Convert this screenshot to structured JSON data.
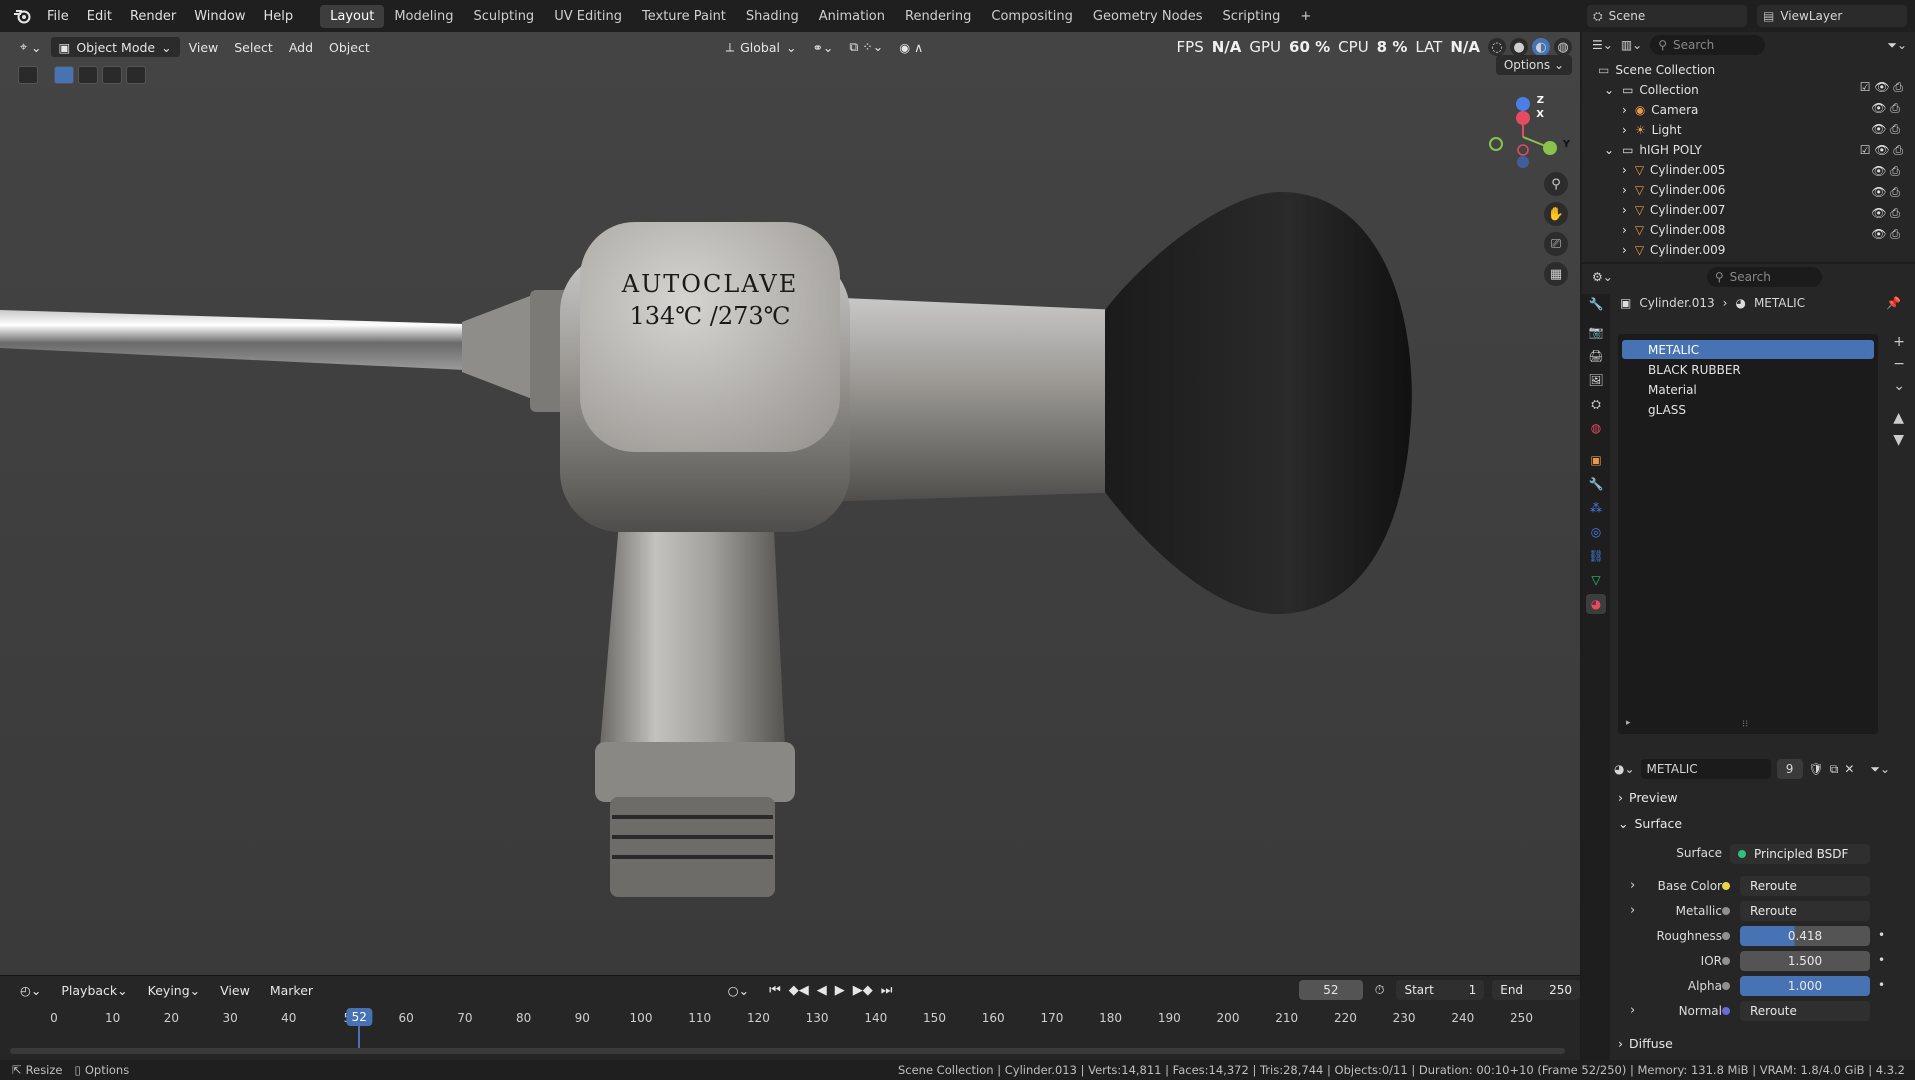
{
  "topbar": {
    "menus": [
      "File",
      "Edit",
      "Render",
      "Window",
      "Help"
    ],
    "workspaces": [
      "Layout",
      "Modeling",
      "Sculpting",
      "UV Editing",
      "Texture Paint",
      "Shading",
      "Animation",
      "Rendering",
      "Compositing",
      "Geometry Nodes",
      "Scripting"
    ],
    "active_workspace": "Layout",
    "scene_label": "Scene",
    "viewlayer_label": "ViewLayer"
  },
  "viewport": {
    "mode": "Object Mode",
    "menus": [
      "View",
      "Select",
      "Add",
      "Object"
    ],
    "transform_orientation": "Global",
    "options_label": "Options",
    "hud": {
      "fps_label": "FPS",
      "fps_value": "N/A",
      "gpu_label": "GPU",
      "gpu_value": "60 %",
      "cpu_label": "CPU",
      "cpu_value": "8 %",
      "lat_label": "LAT",
      "lat_value": "N/A"
    },
    "model_text_line1": "AUTOCLAVE",
    "model_text_line2": "134℃ /273℃",
    "gizmo_axes": [
      "Z",
      "X",
      "Y"
    ]
  },
  "timeline": {
    "menus": [
      "Playback",
      "Keying",
      "View",
      "Marker"
    ],
    "current_frame": "52",
    "start_label": "Start",
    "start_value": "1",
    "end_label": "End",
    "end_value": "250",
    "ticks": [
      "0",
      "10",
      "20",
      "30",
      "40",
      "5",
      "60",
      "70",
      "80",
      "90",
      "100",
      "110",
      "120",
      "130",
      "140",
      "150",
      "160",
      "170",
      "180",
      "190",
      "200",
      "210",
      "220",
      "230",
      "240",
      "250"
    ]
  },
  "outliner": {
    "search_placeholder": "Search",
    "rows": [
      {
        "label": "Scene Collection"
      },
      {
        "label": "Collection"
      },
      {
        "label": "Camera"
      },
      {
        "label": "Light"
      },
      {
        "label": "hIGH POLY"
      },
      {
        "label": "Cylinder.005"
      },
      {
        "label": "Cylinder.006"
      },
      {
        "label": "Cylinder.007"
      },
      {
        "label": "Cylinder.008"
      },
      {
        "label": "Cylinder.009"
      }
    ]
  },
  "properties": {
    "search_placeholder": "Search",
    "breadcrumb_object": "Cylinder.013",
    "breadcrumb_material": "METALIC",
    "materials": [
      "METALIC",
      "BLACK RUBBER",
      "Material",
      "gLASS"
    ],
    "selected_material": "METALIC",
    "material_users": "9",
    "sections": {
      "preview": "Preview",
      "surface": "Surface",
      "diffuse": "Diffuse"
    },
    "surface_label": "Surface",
    "surface_value": "Principled BSDF",
    "params": [
      {
        "label": "Base Color",
        "value": "Reroute"
      },
      {
        "label": "Metallic",
        "value": "Reroute"
      },
      {
        "label": "Roughness",
        "value": "0.418"
      },
      {
        "label": "IOR",
        "value": "1.500"
      },
      {
        "label": "Alpha",
        "value": "1.000"
      },
      {
        "label": "Normal",
        "value": "Reroute"
      }
    ]
  },
  "statusbar": {
    "left1": "Resize",
    "left2": "Options",
    "right": "Scene Collection | Cylinder.013 | Verts:14,811 | Faces:14,372 | Tris:28,744 | Objects:0/11 | Duration: 00:10+10 (Frame 52/250) | Memory: 131.8 MiB | VRAM: 1.8/4.0 GiB | 4.3.2"
  },
  "colors": {
    "accent": "#4772b3",
    "x_axis": "#e84a5f",
    "y_axis": "#8bc34a",
    "z_axis": "#4a7fe8"
  }
}
